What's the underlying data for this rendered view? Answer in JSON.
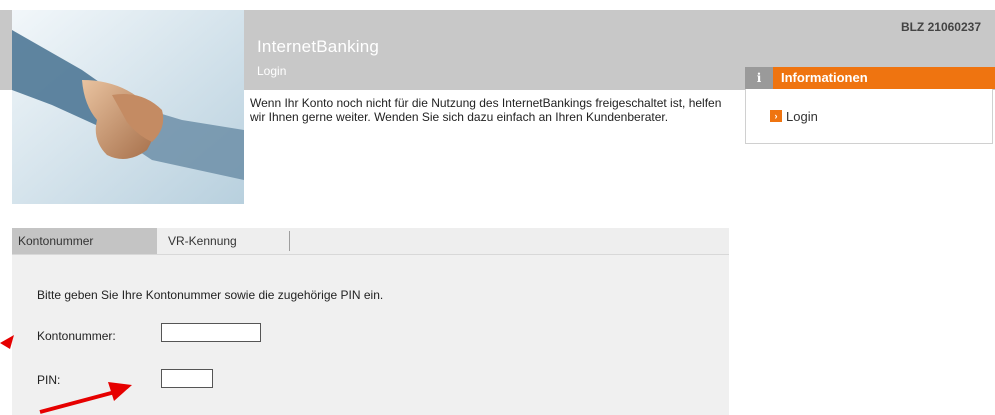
{
  "header": {
    "app_title": "InternetBanking",
    "app_subtitle": "Login",
    "blz": "BLZ 21060237",
    "intro": "Wenn Ihr Konto noch nicht für die Nutzung des InternetBankings freigeschaltet ist, helfen wir Ihnen gerne weiter. Wenden Sie sich dazu einfach an Ihren Kundenberater."
  },
  "info": {
    "icon": "i",
    "title": "Informationen",
    "bullet": "›",
    "link": "Login"
  },
  "tabs": [
    {
      "label": "Kontonummer",
      "active": true
    },
    {
      "label": "VR-Kennung",
      "active": false
    }
  ],
  "form": {
    "instruction": "Bitte geben Sie Ihre Kontonummer sowie die zugehörige PIN ein.",
    "konto_label": "Kontonummer:",
    "pin_label": "PIN:",
    "konto_value": "",
    "pin_value": ""
  },
  "colors": {
    "accent": "#ef7410",
    "header_band": "#c8c8c8",
    "arrow": "#e60000"
  }
}
